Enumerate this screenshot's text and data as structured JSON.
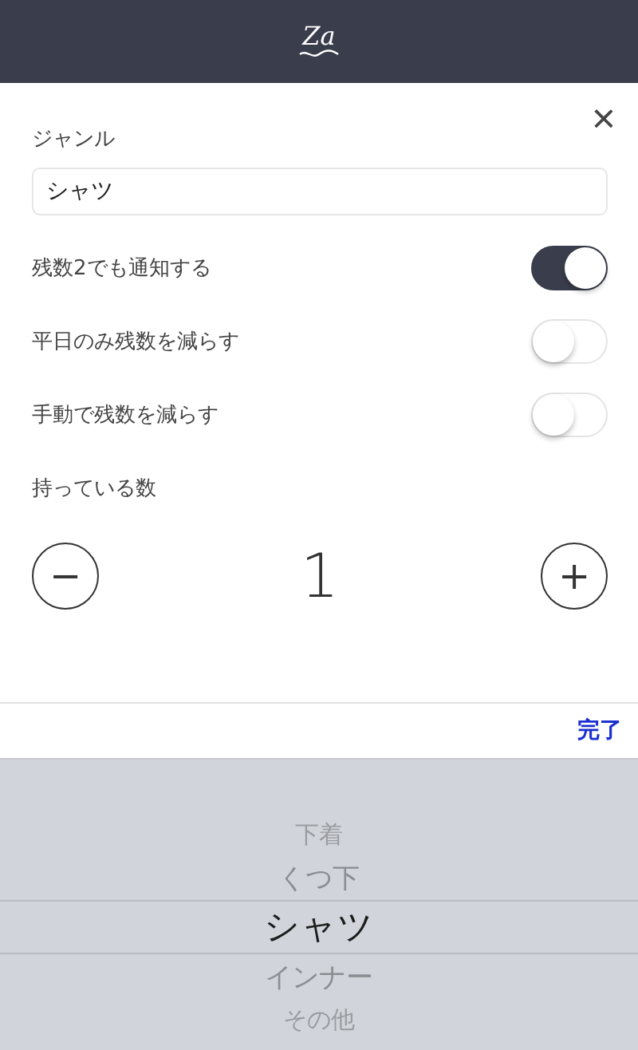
{
  "header": {
    "logo": "Za"
  },
  "form": {
    "close": "×",
    "genre_label": "ジャンル",
    "genre_value": "シャツ",
    "toggles": [
      {
        "label": "残数2でも通知する",
        "on": true
      },
      {
        "label": "平日のみ残数を減らす",
        "on": false
      },
      {
        "label": "手動で残数を減らす",
        "on": false
      }
    ],
    "count_label": "持っている数",
    "count": "1",
    "minus": "−",
    "plus": "+"
  },
  "toolbar": {
    "done": "完了"
  },
  "picker": [
    {
      "label": "下着",
      "selected": false
    },
    {
      "label": "くつ下",
      "selected": false
    },
    {
      "label": "シャツ",
      "selected": true
    },
    {
      "label": "インナー",
      "selected": false
    },
    {
      "label": "その他",
      "selected": false
    }
  ]
}
